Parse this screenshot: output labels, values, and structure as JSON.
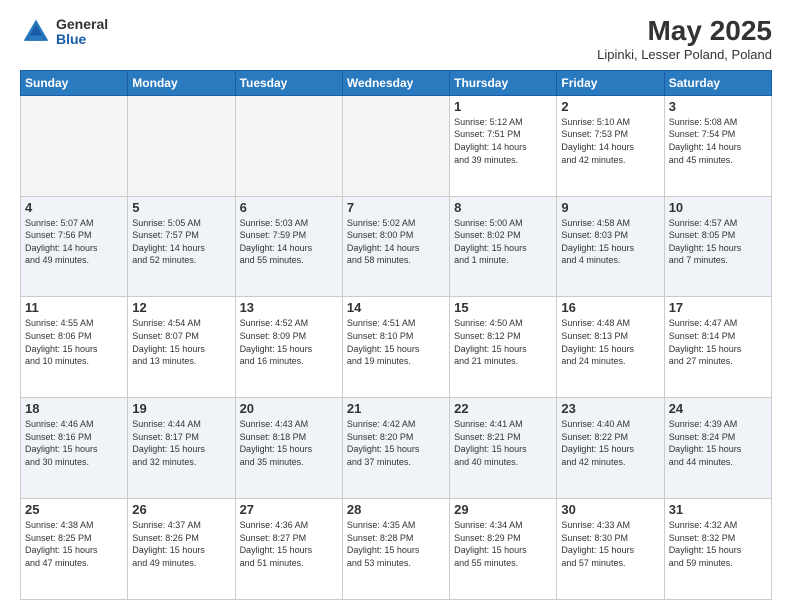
{
  "header": {
    "logo_general": "General",
    "logo_blue": "Blue",
    "title": "May 2025",
    "subtitle": "Lipinki, Lesser Poland, Poland"
  },
  "days_of_week": [
    "Sunday",
    "Monday",
    "Tuesday",
    "Wednesday",
    "Thursday",
    "Friday",
    "Saturday"
  ],
  "weeks": [
    [
      {
        "day": "",
        "info": ""
      },
      {
        "day": "",
        "info": ""
      },
      {
        "day": "",
        "info": ""
      },
      {
        "day": "",
        "info": ""
      },
      {
        "day": "1",
        "info": "Sunrise: 5:12 AM\nSunset: 7:51 PM\nDaylight: 14 hours\nand 39 minutes."
      },
      {
        "day": "2",
        "info": "Sunrise: 5:10 AM\nSunset: 7:53 PM\nDaylight: 14 hours\nand 42 minutes."
      },
      {
        "day": "3",
        "info": "Sunrise: 5:08 AM\nSunset: 7:54 PM\nDaylight: 14 hours\nand 45 minutes."
      }
    ],
    [
      {
        "day": "4",
        "info": "Sunrise: 5:07 AM\nSunset: 7:56 PM\nDaylight: 14 hours\nand 49 minutes."
      },
      {
        "day": "5",
        "info": "Sunrise: 5:05 AM\nSunset: 7:57 PM\nDaylight: 14 hours\nand 52 minutes."
      },
      {
        "day": "6",
        "info": "Sunrise: 5:03 AM\nSunset: 7:59 PM\nDaylight: 14 hours\nand 55 minutes."
      },
      {
        "day": "7",
        "info": "Sunrise: 5:02 AM\nSunset: 8:00 PM\nDaylight: 14 hours\nand 58 minutes."
      },
      {
        "day": "8",
        "info": "Sunrise: 5:00 AM\nSunset: 8:02 PM\nDaylight: 15 hours\nand 1 minute."
      },
      {
        "day": "9",
        "info": "Sunrise: 4:58 AM\nSunset: 8:03 PM\nDaylight: 15 hours\nand 4 minutes."
      },
      {
        "day": "10",
        "info": "Sunrise: 4:57 AM\nSunset: 8:05 PM\nDaylight: 15 hours\nand 7 minutes."
      }
    ],
    [
      {
        "day": "11",
        "info": "Sunrise: 4:55 AM\nSunset: 8:06 PM\nDaylight: 15 hours\nand 10 minutes."
      },
      {
        "day": "12",
        "info": "Sunrise: 4:54 AM\nSunset: 8:07 PM\nDaylight: 15 hours\nand 13 minutes."
      },
      {
        "day": "13",
        "info": "Sunrise: 4:52 AM\nSunset: 8:09 PM\nDaylight: 15 hours\nand 16 minutes."
      },
      {
        "day": "14",
        "info": "Sunrise: 4:51 AM\nSunset: 8:10 PM\nDaylight: 15 hours\nand 19 minutes."
      },
      {
        "day": "15",
        "info": "Sunrise: 4:50 AM\nSunset: 8:12 PM\nDaylight: 15 hours\nand 21 minutes."
      },
      {
        "day": "16",
        "info": "Sunrise: 4:48 AM\nSunset: 8:13 PM\nDaylight: 15 hours\nand 24 minutes."
      },
      {
        "day": "17",
        "info": "Sunrise: 4:47 AM\nSunset: 8:14 PM\nDaylight: 15 hours\nand 27 minutes."
      }
    ],
    [
      {
        "day": "18",
        "info": "Sunrise: 4:46 AM\nSunset: 8:16 PM\nDaylight: 15 hours\nand 30 minutes."
      },
      {
        "day": "19",
        "info": "Sunrise: 4:44 AM\nSunset: 8:17 PM\nDaylight: 15 hours\nand 32 minutes."
      },
      {
        "day": "20",
        "info": "Sunrise: 4:43 AM\nSunset: 8:18 PM\nDaylight: 15 hours\nand 35 minutes."
      },
      {
        "day": "21",
        "info": "Sunrise: 4:42 AM\nSunset: 8:20 PM\nDaylight: 15 hours\nand 37 minutes."
      },
      {
        "day": "22",
        "info": "Sunrise: 4:41 AM\nSunset: 8:21 PM\nDaylight: 15 hours\nand 40 minutes."
      },
      {
        "day": "23",
        "info": "Sunrise: 4:40 AM\nSunset: 8:22 PM\nDaylight: 15 hours\nand 42 minutes."
      },
      {
        "day": "24",
        "info": "Sunrise: 4:39 AM\nSunset: 8:24 PM\nDaylight: 15 hours\nand 44 minutes."
      }
    ],
    [
      {
        "day": "25",
        "info": "Sunrise: 4:38 AM\nSunset: 8:25 PM\nDaylight: 15 hours\nand 47 minutes."
      },
      {
        "day": "26",
        "info": "Sunrise: 4:37 AM\nSunset: 8:26 PM\nDaylight: 15 hours\nand 49 minutes."
      },
      {
        "day": "27",
        "info": "Sunrise: 4:36 AM\nSunset: 8:27 PM\nDaylight: 15 hours\nand 51 minutes."
      },
      {
        "day": "28",
        "info": "Sunrise: 4:35 AM\nSunset: 8:28 PM\nDaylight: 15 hours\nand 53 minutes."
      },
      {
        "day": "29",
        "info": "Sunrise: 4:34 AM\nSunset: 8:29 PM\nDaylight: 15 hours\nand 55 minutes."
      },
      {
        "day": "30",
        "info": "Sunrise: 4:33 AM\nSunset: 8:30 PM\nDaylight: 15 hours\nand 57 minutes."
      },
      {
        "day": "31",
        "info": "Sunrise: 4:32 AM\nSunset: 8:32 PM\nDaylight: 15 hours\nand 59 minutes."
      }
    ]
  ]
}
